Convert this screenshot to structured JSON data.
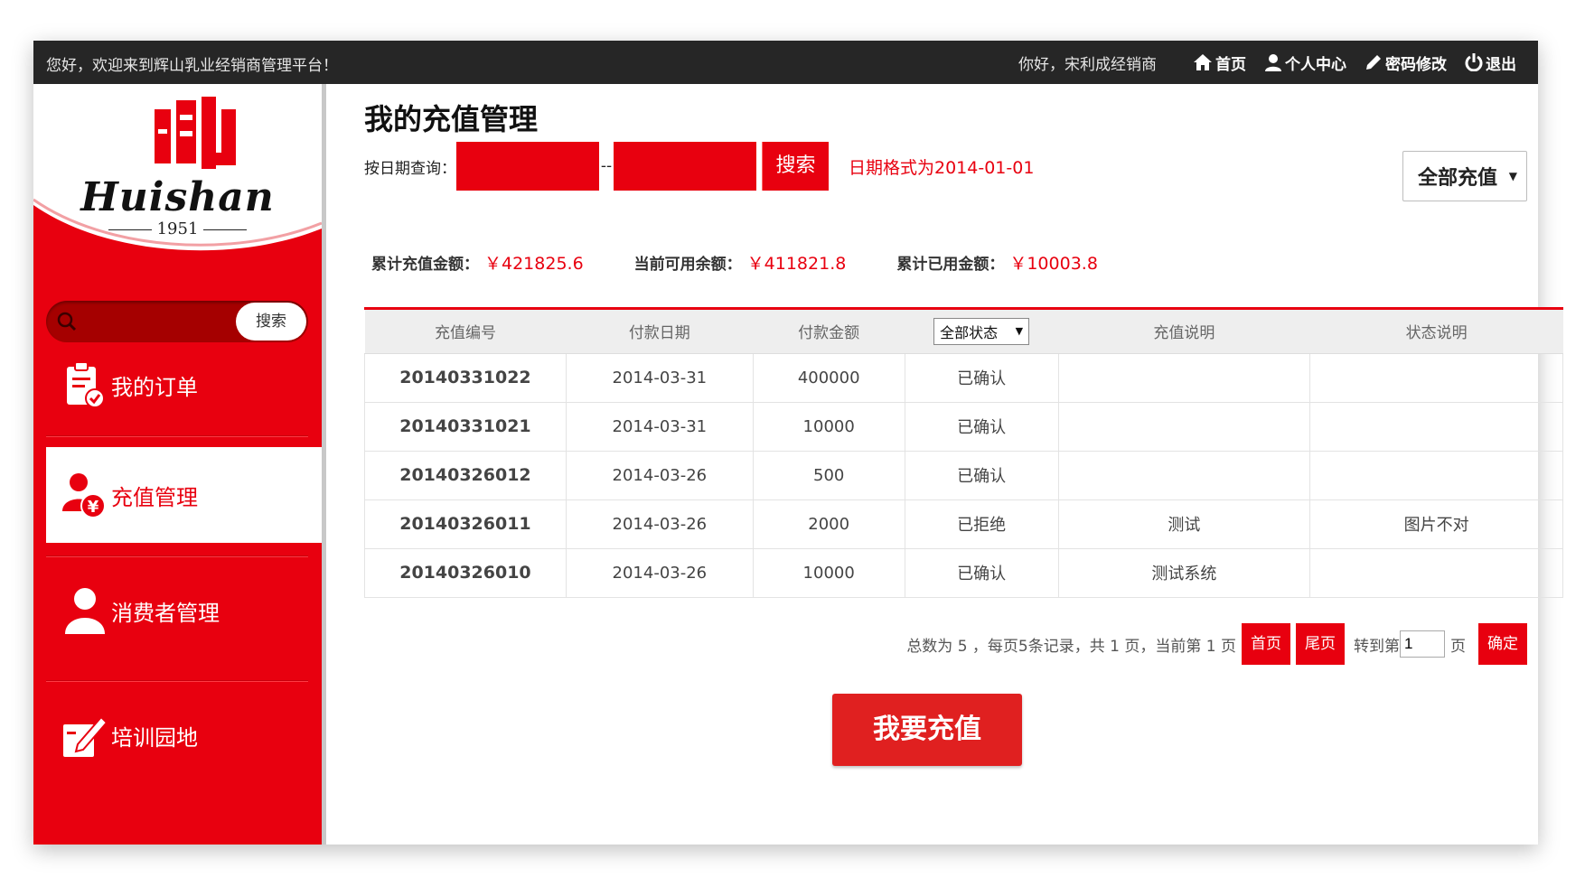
{
  "topbar": {
    "welcome": "您好，欢迎来到辉山乳业经销商管理平台！",
    "greeting": "你好，宋利成经销商",
    "links": {
      "home": "首页",
      "profile": "个人中心",
      "password": "密码修改",
      "logout": "退出"
    }
  },
  "sidebar": {
    "logo_text": "Huishan",
    "logo_year": "1951",
    "search_button": "搜索",
    "menu": [
      {
        "label": "我的订单",
        "icon": "clipboard-check-icon"
      },
      {
        "label": "充值管理",
        "icon": "user-yuan-icon"
      },
      {
        "label": "消费者管理",
        "icon": "user-icon"
      },
      {
        "label": "培训园地",
        "icon": "pen-document-icon"
      }
    ]
  },
  "main": {
    "title": "我的充值管理",
    "date_query_label": "按日期查询：",
    "date_separator": "--",
    "search_button": "搜索",
    "date_hint": "日期格式为2014-01-01",
    "type_select": "全部充值",
    "totals": {
      "total_label": "累计充值金额：",
      "total_value": "￥421825.6",
      "available_label": "当前可用余额：",
      "available_value": "￥411821.8",
      "used_label": "累计已用金额：",
      "used_value": "￥10003.8"
    },
    "table": {
      "headers": [
        "充值编号",
        "付款日期",
        "付款金额",
        "全部状态",
        "充值说明",
        "状态说明"
      ],
      "rows": [
        [
          "20140331022",
          "2014-03-31",
          "400000",
          "已确认",
          "",
          ""
        ],
        [
          "20140331021",
          "2014-03-31",
          "10000",
          "已确认",
          "",
          ""
        ],
        [
          "20140326012",
          "2014-03-26",
          "500",
          "已确认",
          "",
          ""
        ],
        [
          "20140326011",
          "2014-03-26",
          "2000",
          "已拒绝",
          "测试",
          "图片不对"
        ],
        [
          "20140326010",
          "2014-03-26",
          "10000",
          "已确认",
          "测试系统",
          ""
        ]
      ]
    },
    "pager": {
      "summary": "总数为 5 ，每页5条记录，共 1 页，当前第  1 页",
      "first": "首页",
      "last": "尾页",
      "goto_label": "转到第",
      "goto_value": "1",
      "page_unit": "页",
      "confirm": "确定"
    },
    "recharge_button": "我要充值"
  },
  "colors": {
    "brand_red": "#e8000f",
    "topbar_bg": "#262626"
  }
}
